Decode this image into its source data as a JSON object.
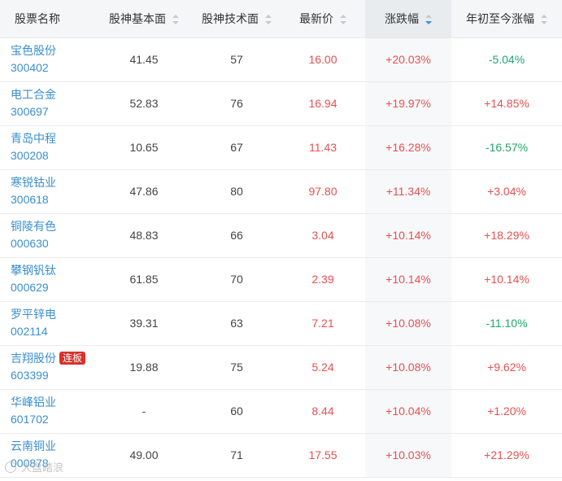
{
  "headers": {
    "name": "股票名称",
    "fundamental": "股神基本面",
    "technical": "股神技术面",
    "price": "最新价",
    "change": "涨跌幅",
    "ytd": "年初至今涨幅"
  },
  "colors": {
    "up": "#e94f4f",
    "down": "#1fa66a",
    "link": "#3a8fd0",
    "badge": "#d9312c"
  },
  "rows": [
    {
      "name": "宝色股份",
      "code": "300402",
      "badge": "",
      "fundamental": "41.45",
      "technical": "57",
      "price": "16.00",
      "change": "+20.03%",
      "ytd": "-5.04%",
      "ytd_dir": "down"
    },
    {
      "name": "电工合金",
      "code": "300697",
      "badge": "",
      "fundamental": "52.83",
      "technical": "76",
      "price": "16.94",
      "change": "+19.97%",
      "ytd": "+14.85%",
      "ytd_dir": "up"
    },
    {
      "name": "青岛中程",
      "code": "300208",
      "badge": "",
      "fundamental": "10.65",
      "technical": "67",
      "price": "11.43",
      "change": "+16.28%",
      "ytd": "-16.57%",
      "ytd_dir": "down"
    },
    {
      "name": "寒锐钴业",
      "code": "300618",
      "badge": "",
      "fundamental": "47.86",
      "technical": "80",
      "price": "97.80",
      "change": "+11.34%",
      "ytd": "+3.04%",
      "ytd_dir": "up"
    },
    {
      "name": "铜陵有色",
      "code": "000630",
      "badge": "",
      "fundamental": "48.83",
      "technical": "66",
      "price": "3.04",
      "change": "+10.14%",
      "ytd": "+18.29%",
      "ytd_dir": "up"
    },
    {
      "name": "攀钢钒钛",
      "code": "000629",
      "badge": "",
      "fundamental": "61.85",
      "technical": "70",
      "price": "2.39",
      "change": "+10.14%",
      "ytd": "+10.14%",
      "ytd_dir": "up"
    },
    {
      "name": "罗平锌电",
      "code": "002114",
      "badge": "",
      "fundamental": "39.31",
      "technical": "63",
      "price": "7.21",
      "change": "+10.08%",
      "ytd": "-11.10%",
      "ytd_dir": "down"
    },
    {
      "name": "吉翔股份",
      "code": "603399",
      "badge": "连板",
      "fundamental": "19.88",
      "technical": "75",
      "price": "5.24",
      "change": "+10.08%",
      "ytd": "+9.62%",
      "ytd_dir": "up"
    },
    {
      "name": "华峰铝业",
      "code": "601702",
      "badge": "",
      "fundamental": "-",
      "technical": "60",
      "price": "8.44",
      "change": "+10.04%",
      "ytd": "+1.20%",
      "ytd_dir": "up"
    },
    {
      "name": "云南铜业",
      "code": "000878",
      "badge": "",
      "fundamental": "49.00",
      "technical": "71",
      "price": "17.55",
      "change": "+10.03%",
      "ytd": "+21.29%",
      "ytd_dir": "up"
    }
  ],
  "watermark": "大盘踏浪"
}
